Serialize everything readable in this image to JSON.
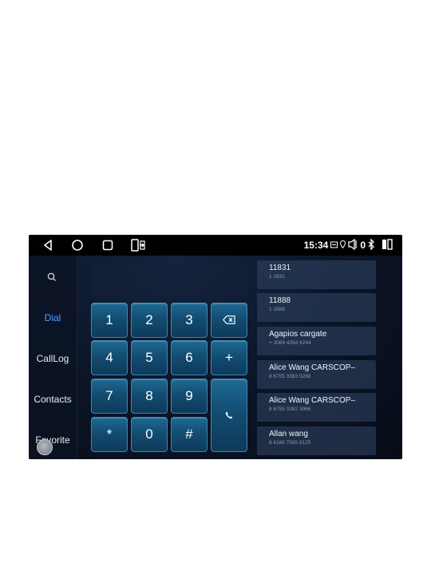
{
  "statusbar": {
    "time": "15:34",
    "icons": [
      "back-icon",
      "home-icon",
      "recents-icon",
      "screen-mirror-icon",
      "sim-icon",
      "location-icon",
      "volume-icon",
      "zero-indicator",
      "bluetooth-icon",
      "split-screen-icon"
    ],
    "zero_indicator": "0"
  },
  "sidebar": {
    "search_icon": "search-icon",
    "items": [
      {
        "label": "Dial",
        "active": true
      },
      {
        "label": "CallLog",
        "active": false
      },
      {
        "label": "Contacts",
        "active": false
      },
      {
        "label": "Favorite",
        "active": false
      }
    ]
  },
  "dialpad": {
    "number_value": "",
    "keys": [
      "1",
      "2",
      "3",
      "4",
      "5",
      "6",
      "+",
      "7",
      "8",
      "9",
      "*",
      "0",
      "#"
    ],
    "backspace_icon": "backspace-icon",
    "call_icon": "phone-icon"
  },
  "contacts": [
    {
      "name": "11831",
      "number": "1 1831"
    },
    {
      "name": "11888",
      "number": "1 1888"
    },
    {
      "name": "Agapios   cargate",
      "number": "+ 3069 4264 6244"
    },
    {
      "name": "Alice Wang   CARSCOP–",
      "number": "8 6755 3383 5288"
    },
    {
      "name": "Alice Wang   CARSCOP–",
      "number": "8 6755 3382 3966"
    },
    {
      "name": "Allan   wang",
      "number": "8 6186 7585 8125"
    }
  ],
  "colors": {
    "accent": "#4aa3ff",
    "key_fill": "#134d72",
    "key_border": "#3c87b5",
    "background": "#0b1426"
  }
}
